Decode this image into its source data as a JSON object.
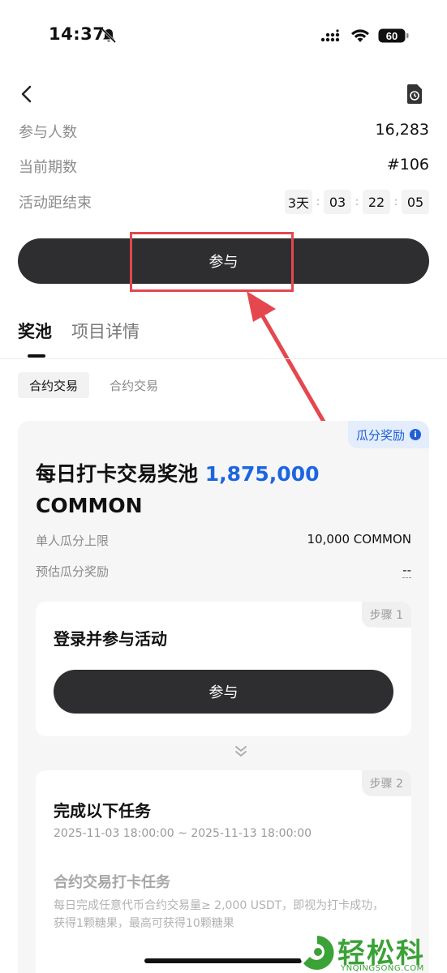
{
  "status_bar": {
    "time": "14:37",
    "battery": "60"
  },
  "stats": {
    "participants_label": "参与人数",
    "participants_value": "16,283",
    "period_label": "当前期数",
    "period_value": "#106",
    "countdown_label": "活动距结束",
    "countdown": {
      "days": "3天",
      "hours": "03",
      "minutes": "22",
      "seconds": "05"
    }
  },
  "join_button": "参与",
  "tabs": [
    {
      "label": "奖池",
      "active": true
    },
    {
      "label": "项目详情",
      "active": false
    }
  ],
  "subtabs": [
    {
      "label": "合约交易",
      "active": true
    },
    {
      "label": "合约交易",
      "active": false
    }
  ],
  "pool": {
    "badge": "瓜分奖励",
    "title": "每日打卡交易奖池",
    "amount": "1,875,000",
    "currency": "COMMON",
    "cap_label": "单人瓜分上限",
    "cap_value": "10,000 COMMON",
    "estimate_label": "预估瓜分奖励",
    "estimate_value": "--"
  },
  "step1": {
    "tag": "步骤 1",
    "title": "登录并参与活动",
    "button": "参与"
  },
  "step2": {
    "tag": "步骤 2",
    "title": "完成以下任务",
    "date_range": "2025-11-03 18:00:00 ~ 2025-11-13 18:00:00",
    "task_title": "合约交易打卡任务",
    "task_desc": "每日完成任意代币合约交易量≥ 2,000 USDT，即视为打卡成功，获得1颗糖果，最高可获得10颗糖果"
  },
  "watermark": {
    "text": "轻松科技",
    "sub": "YNQINGSONG.COM"
  },
  "colors": {
    "accent_blue": "#1b66e0",
    "dark_button": "#2e2e30",
    "highlight_red": "#e5474f",
    "watermark_green": "#3aa236"
  }
}
